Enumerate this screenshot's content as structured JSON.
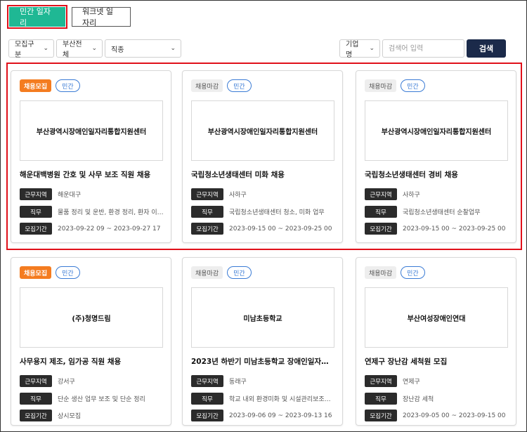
{
  "tabs": [
    {
      "label": "민간 일자리",
      "active": true
    },
    {
      "label": "워크넷 일자리",
      "active": false
    }
  ],
  "filters": [
    {
      "value": "모집구분"
    },
    {
      "value": "부산전체"
    },
    {
      "value": "직종"
    }
  ],
  "search": {
    "type_value": "기업명",
    "placeholder": "검색어 입력",
    "button_label": "검색"
  },
  "labels": {
    "region": "근무지역",
    "duty": "직무",
    "period": "모집기간"
  },
  "colors": {
    "accent": "#1fb894",
    "open_badge": "#f47c20",
    "search_button": "#1b2a4a",
    "highlight": "#e0101a"
  },
  "cards": [
    {
      "status": "채용모집",
      "status_type": "open",
      "category": "민간",
      "org": "부산광역시장애인일자리통합지원센터",
      "title": "해운대백병원 간호 및 사무 보조 직원 채용",
      "region": "해운대구",
      "duty": "물품 정리 및 운반, 환경 정리, 환자 이…",
      "period": "2023-09-22 09 ~ 2023-09-27 17"
    },
    {
      "status": "채용마감",
      "status_type": "closed",
      "category": "민간",
      "org": "부산광역시장애인일자리통합지원센터",
      "title": "국립청소년생태센터 미화 채용",
      "region": "사하구",
      "duty": "국립청소년생태센터 청소, 미화 업무",
      "period": "2023-09-15 00 ~ 2023-09-25 00"
    },
    {
      "status": "채용마감",
      "status_type": "closed",
      "category": "민간",
      "org": "부산광역시장애인일자리통합지원센터",
      "title": "국립청소년생태센터 경비 채용",
      "region": "사하구",
      "duty": "국립청소년생태센터 순찰업무",
      "period": "2023-09-15 00 ~ 2023-09-25 00"
    },
    {
      "status": "채용모집",
      "status_type": "open",
      "category": "민간",
      "org": "(주)청명드림",
      "title": "사무용지 제조, 임가공 직원 채용",
      "region": "강서구",
      "duty": "단순 생산 업무 보조 및 단순 정리",
      "period": "상시모집"
    },
    {
      "status": "채용마감",
      "status_type": "closed",
      "category": "민간",
      "org": "미남초등학교",
      "title": "2023년 하반기 미남초등학교 장애인일자리…",
      "region": "동래구",
      "duty": "학교 내외 환경미화 및 시설관리보조…",
      "period": "2023-09-06 09 ~ 2023-09-13 16"
    },
    {
      "status": "채용마감",
      "status_type": "closed",
      "category": "민간",
      "org": "부산여성장애인연대",
      "title": "연제구 장난감 세척원 모집",
      "region": "연제구",
      "duty": "장난감 세척",
      "period": "2023-09-05 00 ~ 2023-09-15 00"
    }
  ]
}
